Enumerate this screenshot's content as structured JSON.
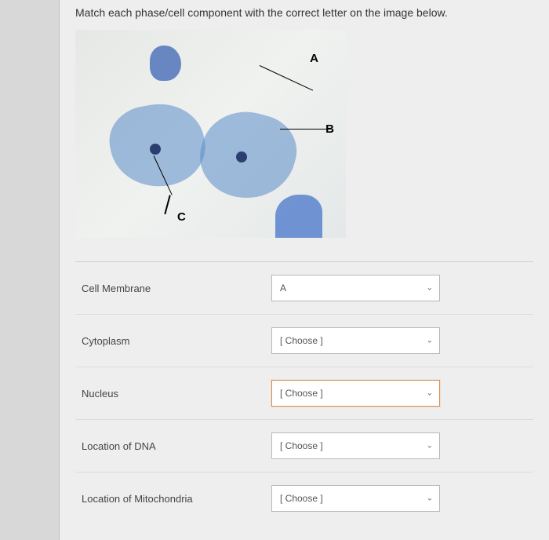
{
  "question": "Match each phase/cell component with the correct letter on the image below.",
  "image_labels": {
    "A": "A",
    "B": "B",
    "C": "C"
  },
  "placeholder": "[ Choose ]",
  "rows": [
    {
      "label": "Cell Membrane",
      "value": "A"
    },
    {
      "label": "Cytoplasm",
      "value": "[ Choose ]"
    },
    {
      "label": "Nucleus",
      "value": "[ Choose ]"
    },
    {
      "label": "Location of DNA",
      "value": "[ Choose ]"
    },
    {
      "label": "Location of Mitochondria",
      "value": "[ Choose ]"
    }
  ]
}
